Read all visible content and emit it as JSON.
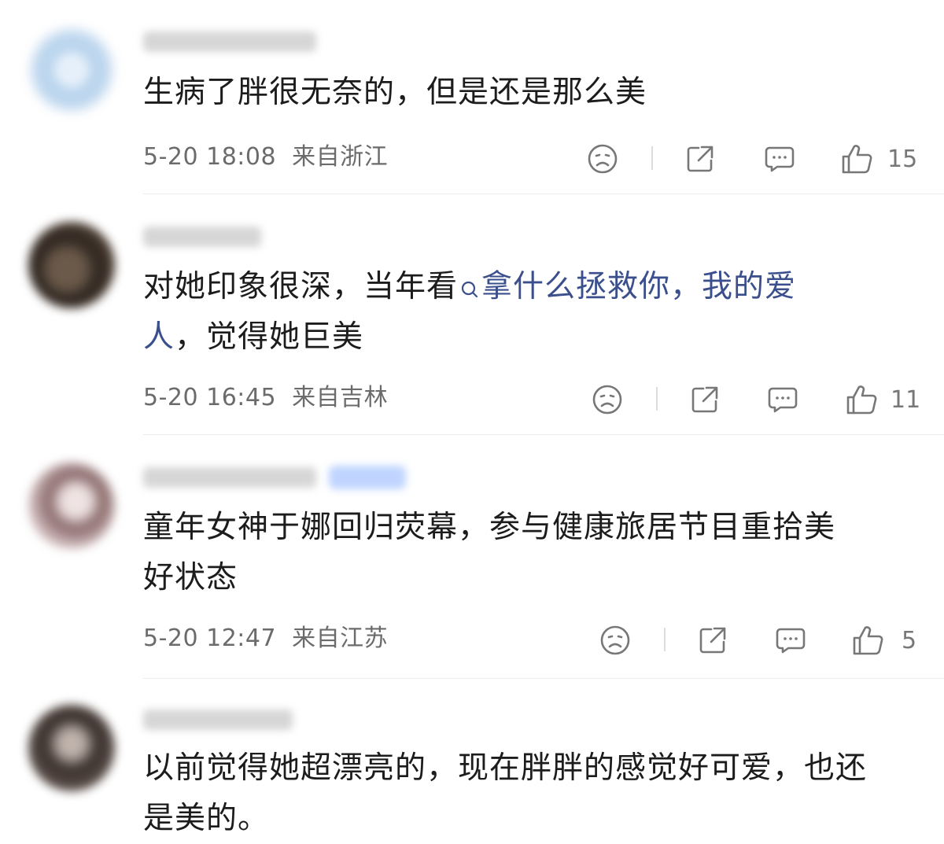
{
  "comments": [
    {
      "text": [
        "生病了胖很无奈的，但是还是那么美"
      ],
      "time": "5-20 18:08",
      "location": "来自浙江",
      "likes": "15"
    },
    {
      "text_before_topic": "对她印象很深，当年看",
      "topic": "拿什么拯救你，我的爱人",
      "topic_line1": "拿什么拯救你，我的爱",
      "topic_line2": "人",
      "text_after_topic": "，觉得她巨美",
      "time": "5-20 16:45",
      "location": "来自吉林",
      "likes": "11"
    },
    {
      "text": [
        "童年女神于娜回归荧幕，参与健康旅居节目重拾美",
        "好状态"
      ],
      "time": "5-20 12:47",
      "location": "来自江苏",
      "likes": "5"
    },
    {
      "text": [
        "以前觉得她超漂亮的，现在胖胖的感觉好可爱，也还",
        "是美的。"
      ]
    }
  ],
  "icons": {
    "dislike": "frown-face-icon",
    "share": "share-icon",
    "comment": "comment-bubble-icon",
    "like": "thumbs-up-icon",
    "topic_search": "search-icon"
  },
  "colors": {
    "topic_link": "#3a4f8c",
    "meta_text": "#6b6b6b",
    "icon": "#777777"
  }
}
